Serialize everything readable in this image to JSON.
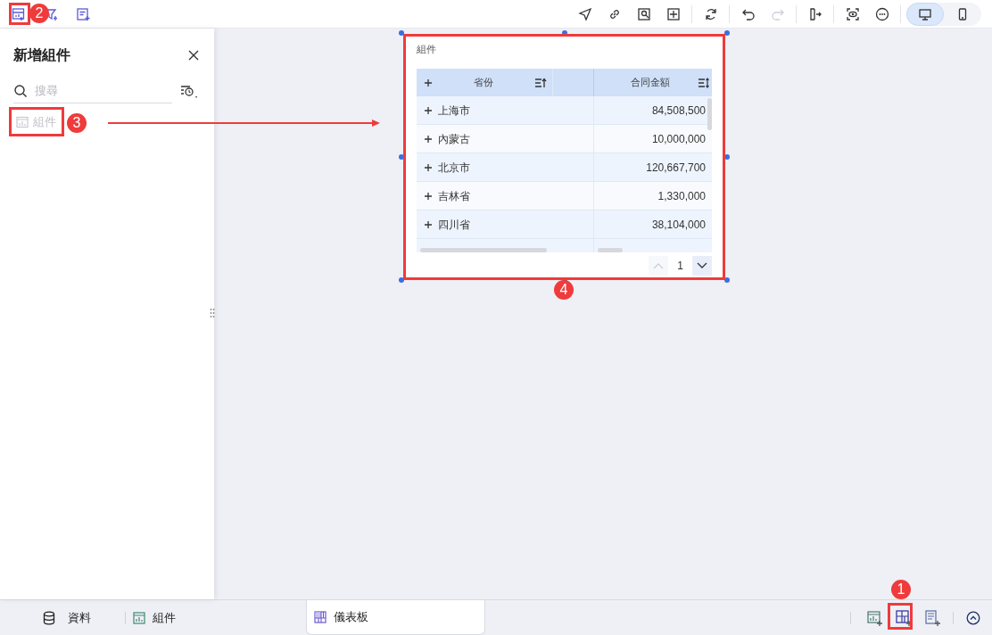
{
  "toolbar": {
    "history": [
      {
        "kind": "undo",
        "disabled": false
      },
      {
        "kind": "redo",
        "disabled": true
      }
    ],
    "device_toggle": [
      {
        "kind": "desktop",
        "selected": true
      },
      {
        "kind": "mobile",
        "selected": false
      }
    ]
  },
  "panel": {
    "title": "新增組件",
    "search": {
      "placeholder": "搜尋"
    },
    "items": [
      {
        "label": "組件",
        "disabled": true
      }
    ]
  },
  "widget": {
    "title": "組件",
    "table": {
      "columns": [
        {
          "label": "省份",
          "sorted_ascending": true
        },
        {
          "label": "合同金額",
          "sorted_ascending": false
        }
      ],
      "rows": [
        [
          "上海市",
          "84,508,500"
        ],
        [
          "內蒙古",
          "10,000,000"
        ],
        [
          "北京市",
          "120,667,700"
        ],
        [
          "吉林省",
          "1,330,000"
        ],
        [
          "四川省",
          "38,104,000"
        ]
      ]
    },
    "pagination": {
      "page": "1",
      "prev_disabled": true,
      "next_disabled": false
    }
  },
  "bottom_tabs": [
    {
      "label": "資料",
      "kind": "data",
      "selected": false
    },
    {
      "label": "組件",
      "kind": "widget",
      "selected": false
    },
    {
      "label": "儀表板",
      "kind": "dashboard",
      "selected": true
    }
  ],
  "annotations": [
    {
      "label": "1"
    },
    {
      "label": "2"
    },
    {
      "label": "3"
    },
    {
      "label": "4"
    }
  ]
}
